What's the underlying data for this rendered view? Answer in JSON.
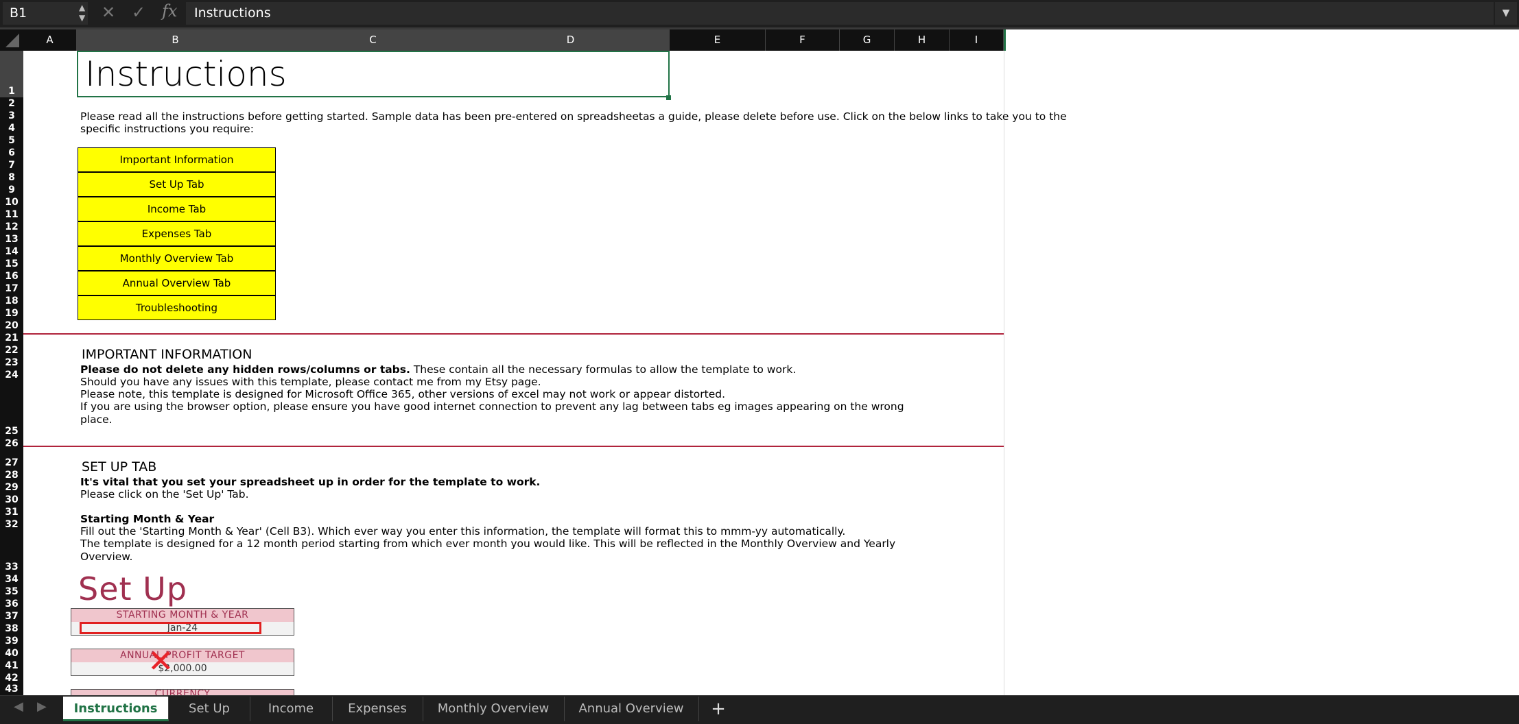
{
  "formula_bar": {
    "name_box": "B1",
    "cancel_icon": "✕",
    "confirm_icon": "✓",
    "fx_label": "fx",
    "content": "Instructions"
  },
  "columns": [
    "A",
    "B",
    "C",
    "D",
    "E",
    "F",
    "G",
    "H",
    "I"
  ],
  "rows": [
    "1",
    "2",
    "3",
    "4",
    "5",
    "6",
    "7",
    "8",
    "9",
    "10",
    "11",
    "12",
    "13",
    "14",
    "15",
    "16",
    "17",
    "18",
    "19",
    "20",
    "21",
    "22",
    "23",
    "24",
    "25",
    "26",
    "27",
    "28",
    "29",
    "30",
    "31",
    "32",
    "33",
    "34",
    "35",
    "36",
    "37",
    "38",
    "39",
    "40",
    "41",
    "42",
    "43"
  ],
  "sheet": {
    "title": "Instructions",
    "intro_line1": "Please read all the instructions before getting started. Sample data has been pre-entered on spreadsheetas a guide, please delete before use. Click on the below links to take you to the",
    "intro_line2": "specific instructions you require:",
    "links": [
      "Important Information",
      "Set Up Tab",
      "Income Tab",
      "Expenses Tab",
      "Monthly Overview Tab",
      "Annual Overview Tab",
      "Troubleshooting"
    ],
    "important": {
      "heading": "IMPORTANT INFORMATION",
      "line1_bold": "Please do not delete any hidden rows/columns or tabs.",
      "line1_rest": " These contain all the necessary formulas to allow the template to work.",
      "line2": "Should you have any issues with this template, please contact me from my Etsy page.",
      "line3": "Please note, this template is designed for Microsoft Office 365, other versions of excel may not work or appear distorted.",
      "line4": "If you are using the browser option, please ensure you have good internet connection to prevent any lag between tabs eg images appearing on the wrong",
      "line5": "place."
    },
    "setup": {
      "heading": "SET UP TAB",
      "line1_bold": "It's vital that you set your spreadsheet up in order for the template to work.",
      "line2": "Please click on the 'Set Up' Tab.",
      "sub_bold": "Starting Month & Year",
      "line3": "Fill out the 'Starting Month & Year' (Cell B3). Which ever way you enter this information, the template will format this to mmm-yy automatically.",
      "line4": "The template is designed for a 12 month period starting from which ever month you would like. This will be reflected in the Monthly Overview and Yearly",
      "line5": "Overview.",
      "image_title": "Set Up",
      "box1_label": "STARTING MONTH & YEAR",
      "box1_value": "Jan-24",
      "box2_label": "ANNUAL PROFIT TARGET",
      "box2_value": "$2,000.00",
      "box3_label": "CURRENCY"
    }
  },
  "tabs": [
    "Instructions",
    "Set Up",
    "Income",
    "Expenses",
    "Monthly Overview",
    "Annual Overview"
  ],
  "add_tab": "+",
  "colors": {
    "accent": "#217346",
    "link_fill": "#ffff00",
    "divider": "#b0233c",
    "setup_pink": "#f0c6cd",
    "setup_text": "#a03050"
  }
}
